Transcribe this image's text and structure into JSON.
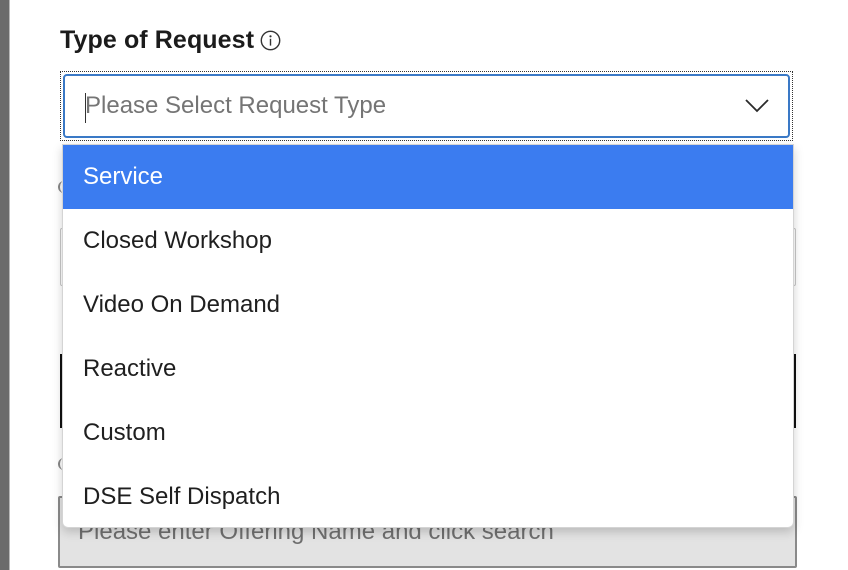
{
  "form": {
    "request_type": {
      "label": "Type of Request",
      "info_icon": "info-circle-icon",
      "placeholder": "Please Select Request Type",
      "chevron_icon": "chevron-down-icon",
      "options": [
        {
          "label": "Service",
          "highlighted": true
        },
        {
          "label": "Closed Workshop",
          "highlighted": false
        },
        {
          "label": "Video On Demand",
          "highlighted": false
        },
        {
          "label": "Reactive",
          "highlighted": false
        },
        {
          "label": "Custom",
          "highlighted": false
        },
        {
          "label": "DSE Self Dispatch",
          "highlighted": false
        }
      ]
    },
    "offering_search": {
      "placeholder": "Please enter Offering Name and click search"
    }
  },
  "colors": {
    "highlight": "#3b7cf0",
    "focus_border": "#3a79c6",
    "disabled_field": "#e3e3e3"
  }
}
